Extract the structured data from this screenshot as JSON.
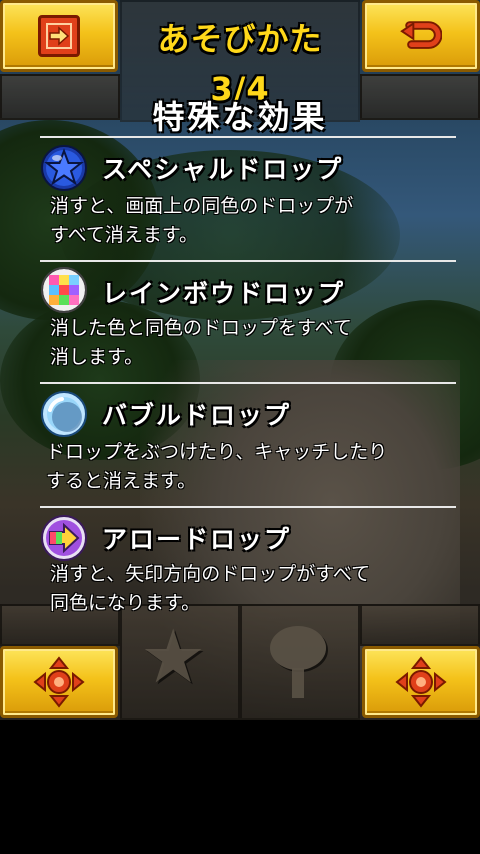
{
  "header": {
    "title": "あそびかた 3/4",
    "left_icon": "next-page-arrow-icon",
    "right_icon": "return-arrow-icon"
  },
  "section_title": "特殊な効果",
  "items": [
    {
      "name": "スペシャルドロップ",
      "desc_line1": "消すと、画面上の同色のドロップが",
      "desc_line2": "すべて消えます。",
      "icon": "blue-star-drop-icon"
    },
    {
      "name": "レインボウドロップ",
      "desc_line1": "消した色と同色のドロップをすべて",
      "desc_line2": "消します。",
      "icon": "rainbow-drop-icon"
    },
    {
      "name": "バブルドロップ",
      "desc_line1": "ドロップをぶつけたり、キャッチしたり",
      "desc_line2": "すると消えます。",
      "icon": "bubble-drop-icon"
    },
    {
      "name": "アロードロップ",
      "desc_line1": "消すと、矢印方向のドロップがすべて",
      "desc_line2": "同色になります。",
      "icon": "arrow-drop-icon"
    }
  ],
  "footer": {
    "left_icon": "direction-pad-icon",
    "right_icon": "direction-pad-icon"
  },
  "colors": {
    "gold": "#f4c21a",
    "title_yellow": "#ffd81a",
    "icon_red": "#e0401a"
  }
}
